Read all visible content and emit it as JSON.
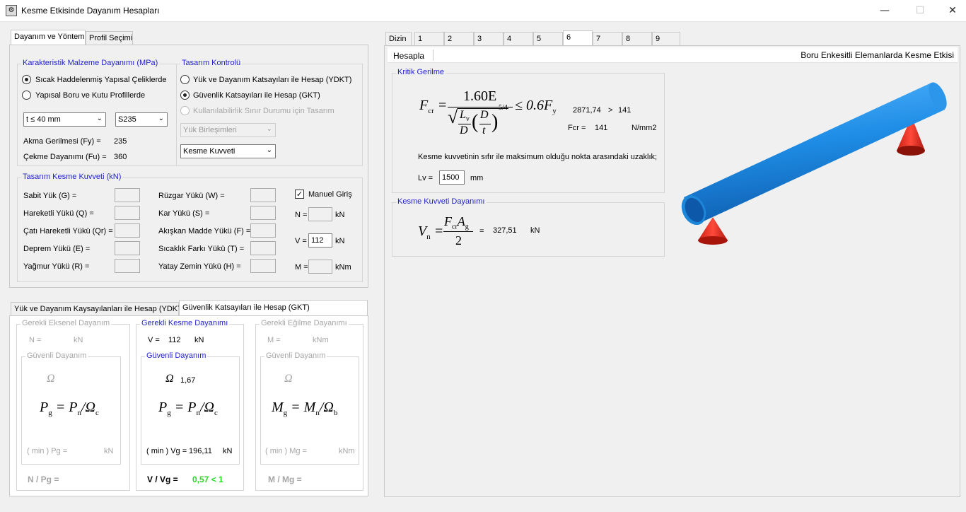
{
  "window": {
    "title": "Kesme Etkisinde Dayanım Hesapları",
    "icon": "app-icon",
    "controls": {
      "minimize": "—",
      "maximize": "☐",
      "close": "✕"
    }
  },
  "left_tabs": [
    "Dayanım ve Yöntem",
    "Profil Seçimi"
  ],
  "material": {
    "title": "Karakteristik Malzeme Dayanımı (MPa)",
    "option1": "Sıcak Haddelenmiş Yapısal Çeliklerde",
    "option2": "Yapısal Boru ve Kutu Profillerde",
    "thickness": "t ≤ 40 mm",
    "steel": "S235",
    "fy_label": "Akma Gerilmesi (Fy) =",
    "fy_value": "235",
    "fu_label": "Çekme Dayanımı (Fu) =",
    "fu_value": "360"
  },
  "design": {
    "title": "Tasarım Kontrolü",
    "option1": "Yük ve Dayanım Katsayıları ile Hesap (YDKT)",
    "option2": "Güvenlik Katsayıları ile Hesap (GKT)",
    "option3": "Kullanılabilirlik Sınır Durumu için Tasarım",
    "combo1": "Yük Birleşimleri",
    "combo2": "Kesme Kuvveti"
  },
  "loads": {
    "title": "Tasarım Kesme Kuvveti (kN)",
    "col1": [
      "Sabit Yük (G) =",
      "Hareketli Yükü (Q) =",
      "Çatı Hareketli Yükü (Qr) =",
      "Deprem Yükü (E) =",
      "Yağmur Yükü (R) ="
    ],
    "col2": [
      "Rüzgar Yükü (W) =",
      "Kar Yükü (S) =",
      "Akışkan Madde Yükü (F) =",
      "Sıcaklık Farkı Yükü (T) =",
      "Yatay Zemin Yükü (H) ="
    ],
    "manual_label": "Manuel Giriş",
    "n_label": "N =",
    "n_unit": "kN",
    "v_label": "V =",
    "v_value": "112",
    "v_unit": "kN",
    "m_label": "M =",
    "m_unit": "kNm"
  },
  "bottom_tabs": [
    "Yük ve Dayanım Kaysayılanları ile Hesap (YDKT)",
    "Güvenlik Katsayıları ile Hesap (GKT)"
  ],
  "axial": {
    "title": "Gerekli Eksenel Dayanım",
    "n_label": "N =",
    "n_unit": "kN",
    "safe_title": "Güvenli Dayanım",
    "omega": "Ω",
    "formula": {
      "lhs": "P",
      "lhs_sub": "g",
      "rhs": "P",
      "rhs_sub": "n",
      "den": "Ω",
      "den_sub": "c"
    },
    "min_label": "( min ) Pg =",
    "min_unit": "kN",
    "ratio": "N / Pg ="
  },
  "shear": {
    "title": "Gerekli Kesme Dayanımı",
    "v_label": "V =",
    "v_value": "112",
    "v_unit": "kN",
    "safe_title": "Güvenli Dayanım",
    "omega": "Ω",
    "omega_value": "1,67",
    "formula": {
      "lhs": "P",
      "lhs_sub": "g",
      "rhs": "P",
      "rhs_sub": "n",
      "den": "Ω",
      "den_sub": "c"
    },
    "min_label": "( min ) Vg =",
    "min_value": "196,11",
    "min_unit": "kN",
    "ratio": "V / Vg =",
    "ratio_value": "0,57 < 1"
  },
  "bending": {
    "title": "Gerekli Eğilme Dayanımı",
    "m_label": "M =",
    "m_unit": "kNm",
    "safe_title": "Güvenli Dayanım",
    "omega": "Ω",
    "formula": {
      "lhs": "M",
      "lhs_sub": "g",
      "rhs": "M",
      "rhs_sub": "n",
      "den": "Ω",
      "den_sub": "b"
    },
    "min_label": "( min ) Mg =",
    "min_unit": "kNm",
    "ratio": "M / Mg ="
  },
  "right_tabs": [
    "Dizin",
    "1",
    "2",
    "3",
    "4",
    "5",
    "6",
    "7",
    "8",
    "9"
  ],
  "right_toolbar": {
    "button": "Hesapla",
    "title": "Boru Enkesitli Elemanlarda Kesme Etkisi"
  },
  "critical": {
    "title": "Kritik Gerilme",
    "compare_left": "2871,74",
    "compare_op": ">",
    "compare_right": "141",
    "fcr_label": "Fcr =",
    "fcr_value": "141",
    "fcr_unit": "N/mm2",
    "note": "Kesme kuvvetinin sıfır ile maksimum olduğu nokta arasındaki uzaklık;",
    "lv_label": "Lv =",
    "lv_value": "1500",
    "lv_unit": "mm",
    "formula": {
      "lhs": "F",
      "lhs_sub": "cr",
      "num": "1.60E",
      "L": "L",
      "L_sub": "v",
      "D": "D",
      "D2": "D",
      "t": "t",
      "exp": "5/4",
      "rhs": "≤ 0.6F",
      "rhs_sub": "y"
    }
  },
  "nominal": {
    "title": "Kesme Kuvveti Dayanımı",
    "value": "327,51",
    "unit": "kN",
    "formula": {
      "lhs": "V",
      "lhs_sub": "n",
      "num": "F",
      "num_sub1": "cr",
      "num2": "A",
      "num_sub2": "g",
      "den": "2",
      "eq2": "="
    }
  },
  "colors": {
    "group_title": "#1f1fd0",
    "pipe": "#1e8de6",
    "support": "#ff3a2a",
    "ok_ratio": "#22dd22"
  }
}
